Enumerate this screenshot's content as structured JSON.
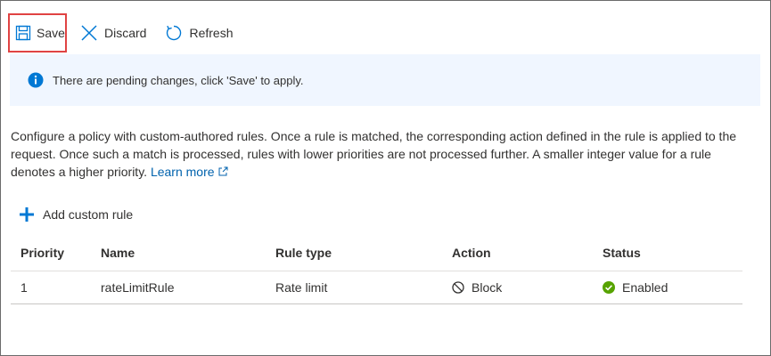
{
  "toolbar": {
    "save_label": "Save",
    "discard_label": "Discard",
    "refresh_label": "Refresh"
  },
  "info_bar": {
    "message": "There are pending changes, click 'Save' to apply."
  },
  "description": {
    "text": "Configure a policy with custom-authored rules. Once a rule is matched, the corresponding action defined in the rule is applied to the request. Once such a match is processed, rules with lower priorities are not processed further. A smaller integer value for a rule denotes a higher priority.",
    "link_label": "Learn more"
  },
  "add_rule": {
    "label": "Add custom rule"
  },
  "table": {
    "headers": {
      "priority": "Priority",
      "name": "Name",
      "rule_type": "Rule type",
      "action": "Action",
      "status": "Status"
    },
    "rows": [
      {
        "priority": "1",
        "name": "rateLimitRule",
        "rule_type": "Rate limit",
        "action": "Block",
        "status": "Enabled"
      }
    ]
  },
  "colors": {
    "accent": "#0078d4",
    "link": "#0062ad",
    "info_bg": "#f0f6ff",
    "highlight_border": "#e04343",
    "enabled_green": "#57a300"
  },
  "icons": {
    "save": "save-icon",
    "discard": "close-icon",
    "refresh": "refresh-icon",
    "info": "info-icon",
    "external_link": "external-link-icon",
    "add": "plus-icon",
    "block": "block-icon",
    "enabled": "check-circle-icon"
  }
}
